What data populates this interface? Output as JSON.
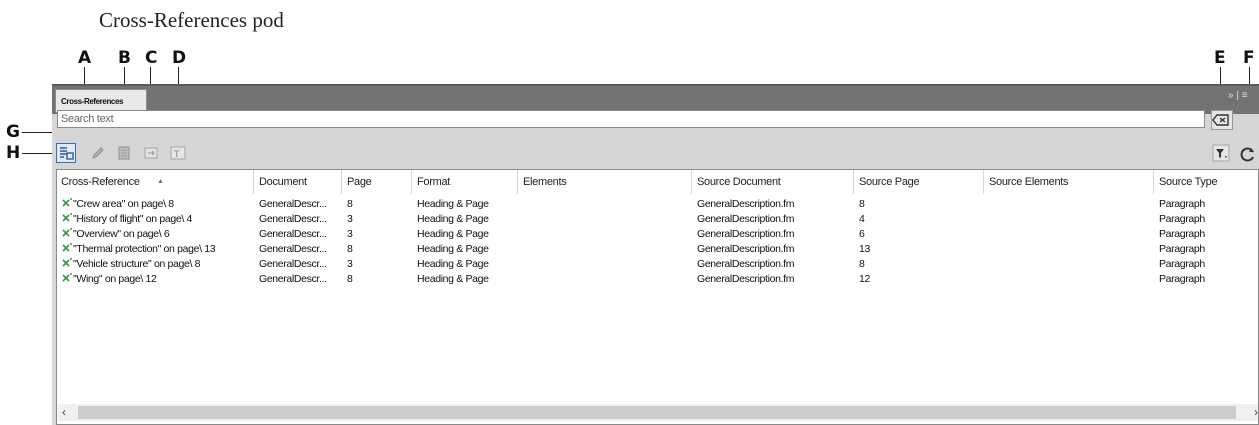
{
  "caption": "Cross-References pod",
  "callouts": {
    "a": "A",
    "b": "B",
    "c": "C",
    "d": "D",
    "e": "E",
    "f": "F",
    "g": "G",
    "h": "H"
  },
  "panel": {
    "tab_label": "Cross-References",
    "tab_menu_glyph": "»",
    "search_placeholder": "Search text"
  },
  "toolbar": {
    "buttons": [
      {
        "name": "show-all-button",
        "icon": "list-toggle-icon",
        "active": true
      },
      {
        "name": "edit-button",
        "icon": "pencil-icon"
      },
      {
        "name": "delete-button",
        "icon": "trash-icon"
      },
      {
        "name": "resolve-button",
        "icon": "link-icon"
      },
      {
        "name": "convert-to-text-button",
        "icon": "convert-text-icon"
      },
      {
        "name": "filter-button",
        "icon": "filter-icon"
      },
      {
        "name": "refresh-button",
        "icon": "refresh-icon"
      },
      {
        "name": "clear-search-button",
        "icon": "clear-icon"
      }
    ]
  },
  "table": {
    "headers": [
      "Cross-Reference",
      "Document",
      "Page",
      "Format",
      "Elements",
      "Source Document",
      "Source Page",
      "Source Elements",
      "Source Type"
    ],
    "sort_indicator": "▲",
    "rows": [
      [
        "\"Crew area\" on page\\ 8",
        "GeneralDescr...",
        "8",
        "Heading & Page",
        "",
        "GeneralDescription.fm",
        "8",
        "",
        "Paragraph"
      ],
      [
        "\"History of flight\" on page\\ 4",
        "GeneralDescr...",
        "3",
        "Heading & Page",
        "",
        "GeneralDescription.fm",
        "4",
        "",
        "Paragraph"
      ],
      [
        "\"Overview\" on page\\ 6",
        "GeneralDescr...",
        "3",
        "Heading & Page",
        "",
        "GeneralDescription.fm",
        "6",
        "",
        "Paragraph"
      ],
      [
        "\"Thermal protection\" on page\\ 13",
        "GeneralDescr...",
        "8",
        "Heading & Page",
        "",
        "GeneralDescription.fm",
        "13",
        "",
        "Paragraph"
      ],
      [
        "\"Vehicle structure\" on page\\ 8",
        "GeneralDescr...",
        "3",
        "Heading & Page",
        "",
        "GeneralDescription.fm",
        "8",
        "",
        "Paragraph"
      ],
      [
        "\"Wing\" on page\\ 12",
        "GeneralDescr...",
        "8",
        "Heading & Page",
        "",
        "GeneralDescription.fm",
        "12",
        "",
        "Paragraph"
      ]
    ]
  },
  "colors": {
    "unresolved_icon": "#2e9a3c",
    "active_button_border": "#3f6fa8",
    "titlebar": "#737373"
  }
}
